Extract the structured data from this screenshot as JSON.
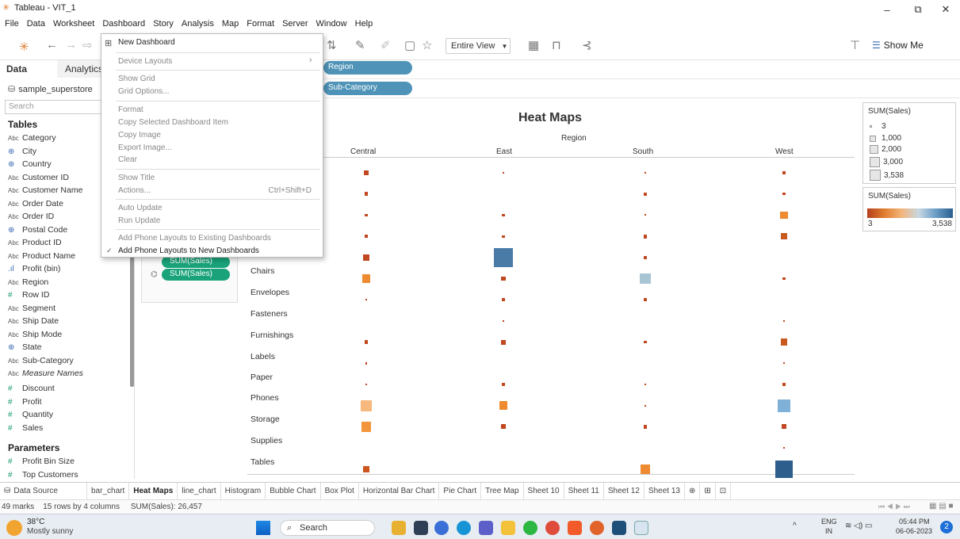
{
  "window": {
    "title": "Tableau - VIT_1",
    "min": "–",
    "max": "⧉",
    "close": "✕"
  },
  "menu": [
    "File",
    "Data",
    "Worksheet",
    "Dashboard",
    "Story",
    "Analysis",
    "Map",
    "Format",
    "Server",
    "Window",
    "Help"
  ],
  "toolbar": {
    "entire_view": "Entire View",
    "show_me": "Show Me"
  },
  "left": {
    "tab_data": "Data",
    "tab_analytics": "Analytics",
    "source": "sample_superstore",
    "search_placeholder": "Search",
    "tables_header": "Tables",
    "fields": [
      {
        "t": "Abc",
        "n": "Category"
      },
      {
        "t": "geo",
        "n": "City"
      },
      {
        "t": "geo",
        "n": "Country"
      },
      {
        "t": "Abc",
        "n": "Customer ID"
      },
      {
        "t": "Abc",
        "n": "Customer Name"
      },
      {
        "t": "Abc",
        "n": "Order Date"
      },
      {
        "t": "Abc",
        "n": "Order ID"
      },
      {
        "t": "geo",
        "n": "Postal Code"
      },
      {
        "t": "Abc",
        "n": "Product ID"
      },
      {
        "t": "Abc",
        "n": "Product Name"
      },
      {
        "t": "bin",
        "n": "Profit (bin)"
      },
      {
        "t": "Abc",
        "n": "Region"
      },
      {
        "t": "#",
        "n": "Row ID"
      },
      {
        "t": "Abc",
        "n": "Segment"
      },
      {
        "t": "Abc",
        "n": "Ship Date"
      },
      {
        "t": "Abc",
        "n": "Ship Mode"
      },
      {
        "t": "geo",
        "n": "State"
      },
      {
        "t": "Abc",
        "n": "Sub-Category"
      },
      {
        "t": "Abc",
        "n": "Measure Names"
      }
    ],
    "measures": [
      "Discount",
      "Profit",
      "Quantity",
      "Sales"
    ],
    "parameters_header": "Parameters",
    "parameters": [
      "Profit Bin Size",
      "Top Customers"
    ]
  },
  "shelves": {
    "columns_pill": "Region",
    "rows_pill": "Sub-Category"
  },
  "marks": {
    "pill1": "SUM(Sales)",
    "pill2": "SUM(Sales)"
  },
  "menu_dropdown": {
    "new_dashboard": "New Dashboard",
    "device_layouts": "Device Layouts",
    "show_grid": "Show Grid",
    "grid_options": "Grid Options...",
    "format": "Format",
    "copy_item": "Copy Selected Dashboard Item",
    "copy_image": "Copy Image",
    "export_image": "Export Image...",
    "clear": "Clear",
    "show_title": "Show Title",
    "actions": "Actions...",
    "actions_shortcut": "Ctrl+Shift+D",
    "auto_update": "Auto Update",
    "run_update": "Run Update",
    "phone_existing": "Add Phone Layouts to Existing Dashboards",
    "phone_new": "Add Phone Layouts to New Dashboards",
    "check": "✓",
    "arrow": "›"
  },
  "viz": {
    "title": "Heat Maps",
    "region_header": "Region",
    "columns": [
      "Central",
      "East",
      "South",
      "West"
    ],
    "rows": [
      "Chairs",
      "Envelopes",
      "Fasteners",
      "Furnishings",
      "Labels",
      "Paper",
      "Phones",
      "Storage",
      "Supplies",
      "Tables"
    ]
  },
  "chart_data": {
    "type": "heatmap",
    "title": "Heat Maps",
    "x_header": "Region",
    "categories_x": [
      "Central",
      "East",
      "South",
      "West"
    ],
    "hidden_rows_count": 5,
    "rows_visible": [
      "Chairs",
      "Envelopes",
      "Fasteners",
      "Furnishings",
      "Labels",
      "Paper",
      "Phones",
      "Storage",
      "Supplies",
      "Tables"
    ],
    "note_colors": "size and color both encode SUM(Sales)",
    "cells": [
      {
        "r": 0,
        "c": 0,
        "v": 220,
        "color": "#c0471f"
      },
      {
        "r": 0,
        "c": 1,
        "v": 40,
        "color": "#c0471f"
      },
      {
        "r": 0,
        "c": 2,
        "v": 40,
        "color": "#c0471f"
      },
      {
        "r": 0,
        "c": 3,
        "v": 140,
        "color": "#c0471f"
      },
      {
        "r": 1,
        "c": 0,
        "v": 130,
        "color": "#c0471f"
      },
      {
        "r": 1,
        "c": 2,
        "v": 110,
        "color": "#c0471f"
      },
      {
        "r": 1,
        "c": 3,
        "v": 60,
        "color": "#c0471f"
      },
      {
        "r": 2,
        "c": 0,
        "v": 60,
        "color": "#c0471f"
      },
      {
        "r": 2,
        "c": 1,
        "v": 60,
        "color": "#c0471f"
      },
      {
        "r": 2,
        "c": 2,
        "v": 10,
        "color": "#c0471f"
      },
      {
        "r": 2,
        "c": 3,
        "v": 520,
        "color": "#ee8a30"
      },
      {
        "r": 3,
        "c": 0,
        "v": 80,
        "color": "#c0471f"
      },
      {
        "r": 3,
        "c": 1,
        "v": 60,
        "color": "#c0471f"
      },
      {
        "r": 3,
        "c": 2,
        "v": 150,
        "color": "#c0471f"
      },
      {
        "r": 3,
        "c": 3,
        "v": 420,
        "color": "#c85a1f"
      },
      {
        "r": 4,
        "c": 0,
        "v": 420,
        "color": "#c0471f"
      },
      {
        "r": 4,
        "c": 1,
        "v": 3538,
        "color": "#4a7ba6"
      },
      {
        "r": 4,
        "c": 2,
        "v": 90,
        "color": "#c0471f"
      },
      {
        "r": 5,
        "c": 0,
        "v": 680,
        "color": "#ee8a30"
      },
      {
        "r": 5,
        "c": 1,
        "v": 220,
        "color": "#c0471f"
      },
      {
        "r": 5,
        "c": 2,
        "v": 1100,
        "color": "#a8c5d3"
      },
      {
        "r": 5,
        "c": 3,
        "v": 60,
        "color": "#c0471f"
      },
      {
        "r": 6,
        "c": 0,
        "v": 40,
        "color": "#c0471f"
      },
      {
        "r": 6,
        "c": 1,
        "v": 130,
        "color": "#c0471f"
      },
      {
        "r": 6,
        "c": 2,
        "v": 130,
        "color": "#c0471f"
      },
      {
        "r": 7,
        "c": 1,
        "v": 20,
        "color": "#c0471f"
      },
      {
        "r": 7,
        "c": 3,
        "v": 5,
        "color": "#c0471f"
      },
      {
        "r": 8,
        "c": 0,
        "v": 130,
        "color": "#c0471f"
      },
      {
        "r": 8,
        "c": 1,
        "v": 220,
        "color": "#c0471f"
      },
      {
        "r": 8,
        "c": 2,
        "v": 60,
        "color": "#c0471f"
      },
      {
        "r": 8,
        "c": 3,
        "v": 420,
        "color": "#c85a1f"
      },
      {
        "r": 9,
        "c": 0,
        "v": 40,
        "color": "#c0471f"
      },
      {
        "r": 9,
        "c": 3,
        "v": 5,
        "color": "#c0471f"
      },
      {
        "r": 10,
        "c": 0,
        "v": 40,
        "color": "#c0471f"
      },
      {
        "r": 10,
        "c": 1,
        "v": 60,
        "color": "#c0471f"
      },
      {
        "r": 10,
        "c": 2,
        "v": 40,
        "color": "#c0471f"
      },
      {
        "r": 10,
        "c": 3,
        "v": 90,
        "color": "#c0471f"
      },
      {
        "r": 11,
        "c": 0,
        "v": 1150,
        "color": "#f6b87c"
      },
      {
        "r": 11,
        "c": 1,
        "v": 700,
        "color": "#ee8a30"
      },
      {
        "r": 11,
        "c": 2,
        "v": 10,
        "color": "#c0471f"
      },
      {
        "r": 11,
        "c": 3,
        "v": 1500,
        "color": "#7fb0d8"
      },
      {
        "r": 12,
        "c": 0,
        "v": 980,
        "color": "#f2963e"
      },
      {
        "r": 12,
        "c": 1,
        "v": 220,
        "color": "#c0471f"
      },
      {
        "r": 12,
        "c": 2,
        "v": 130,
        "color": "#c0471f"
      },
      {
        "r": 12,
        "c": 3,
        "v": 220,
        "color": "#c0471f"
      },
      {
        "r": 13,
        "c": 3,
        "v": 20,
        "color": "#c0471f"
      },
      {
        "r": 14,
        "c": 0,
        "v": 450,
        "color": "#cc5520"
      },
      {
        "r": 14,
        "c": 2,
        "v": 800,
        "color": "#ee8a30"
      },
      {
        "r": 14,
        "c": 3,
        "v": 3000,
        "color": "#2e5f8c"
      }
    ]
  },
  "legend_size": {
    "title": "SUM(Sales)",
    "items": [
      "3",
      "1,000",
      "2,000",
      "3,000",
      "3,538"
    ]
  },
  "legend_color": {
    "title": "SUM(Sales)",
    "min": "3",
    "max": "3,538"
  },
  "sheet_tabs": [
    "Data Source",
    "bar_chart",
    "Heat Maps",
    "line_chart",
    "Histogram",
    "Bubble Chart",
    "Box Plot",
    "Horizontal Bar Chart",
    "Pie Chart",
    "Tree Map",
    "Sheet 10",
    "Sheet 11",
    "Sheet 12",
    "Sheet 13"
  ],
  "status": {
    "marks": "49 marks",
    "dims": "15 rows by 4 columns",
    "sum": "SUM(Sales): 26,457"
  },
  "taskbar": {
    "temp": "38°C",
    "weather": "Mostly sunny",
    "search": "Search",
    "lang": "ENG",
    "lang2": "IN",
    "time": "05:44 PM",
    "date": "06-06-2023",
    "badge": "2"
  }
}
